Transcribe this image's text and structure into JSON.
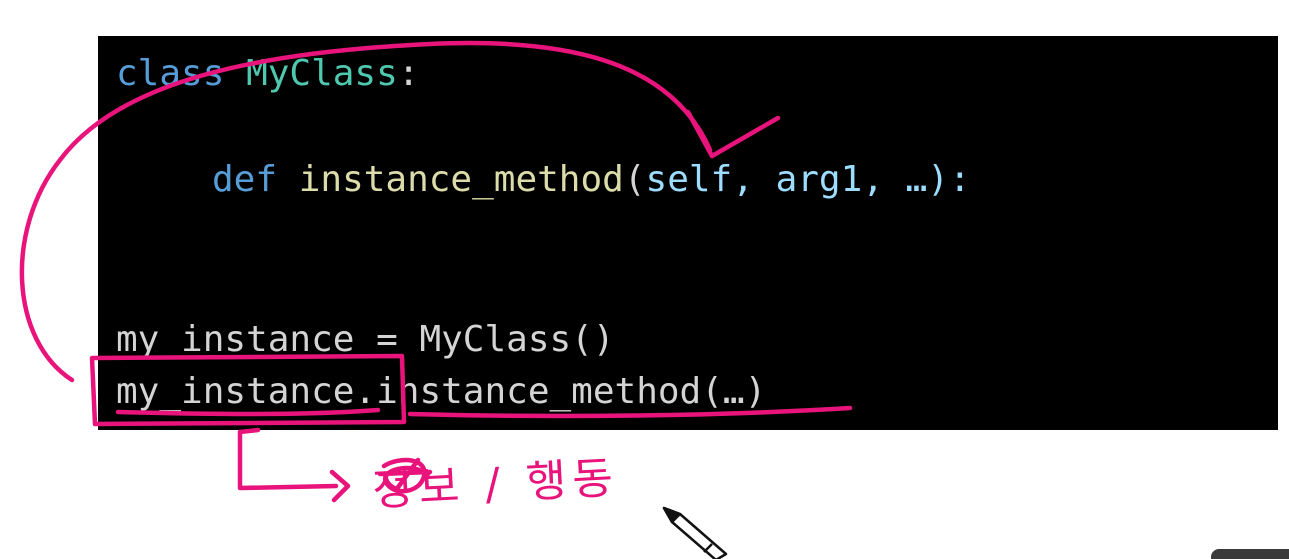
{
  "code": {
    "line1": {
      "keyword": "class",
      "class_name": "MyClass",
      "colon": ":"
    },
    "line2": {
      "keyword": "def",
      "method_name": "instance_method",
      "open_paren": "(",
      "self": "self",
      "rest_args": ", arg1, …):"
    },
    "line3": {
      "var": "my_instance",
      "assign": " = ",
      "call": "MyClass()"
    },
    "line4": {
      "var": "my_instance",
      "dot": ".",
      "method_call": "instance_method(…)"
    }
  },
  "annotation": {
    "note": "정보 / 행동",
    "ink_color": "#e8147c"
  },
  "cursor": {
    "icon": "pencil-cursor-icon"
  }
}
